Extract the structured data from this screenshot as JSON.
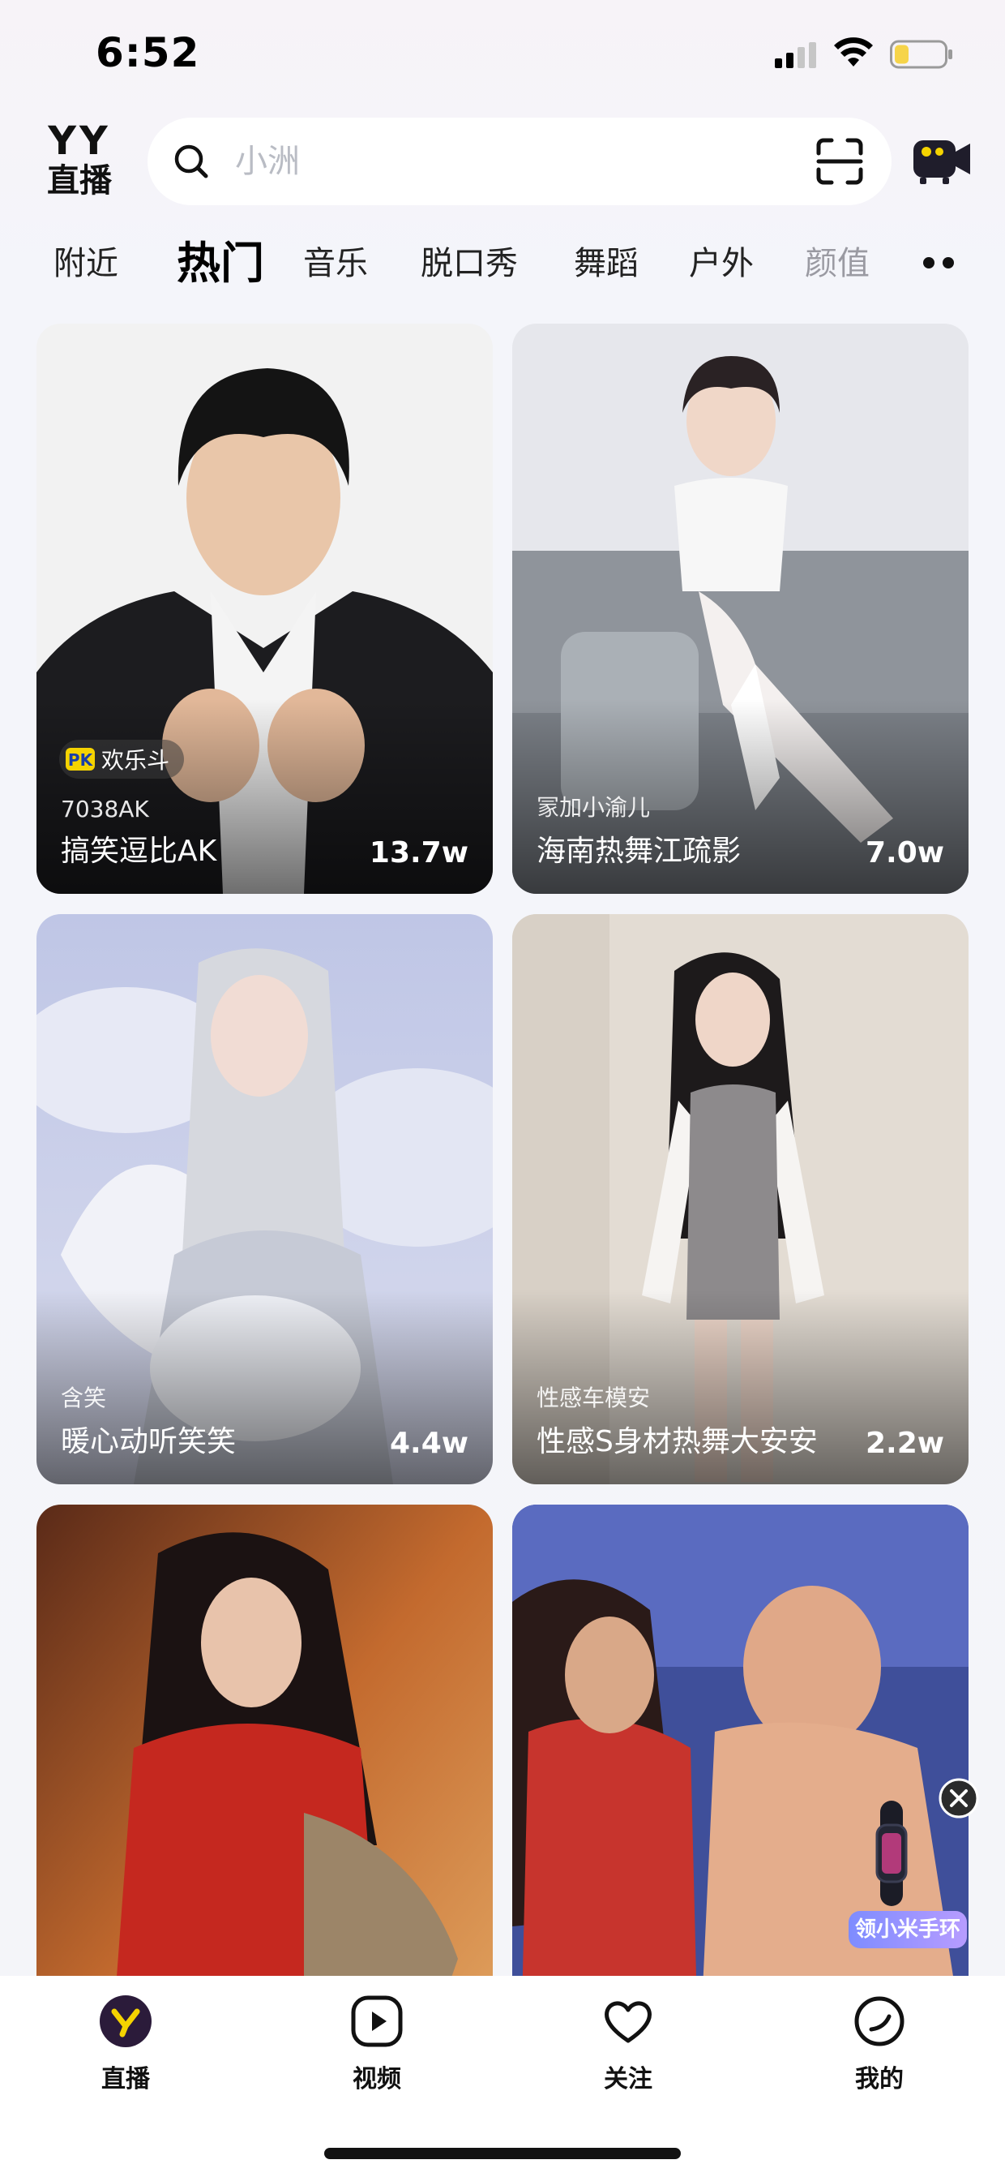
{
  "status_bar": {
    "time": "6:52"
  },
  "header": {
    "logo_top": "YY",
    "logo_bottom": "直播",
    "search_placeholder": "小洲"
  },
  "tabs": [
    {
      "label": "附近"
    },
    {
      "label": "热门",
      "active": true
    },
    {
      "label": "音乐"
    },
    {
      "label": "脱口秀"
    },
    {
      "label": "舞蹈"
    },
    {
      "label": "户外"
    },
    {
      "label": "颜值"
    }
  ],
  "cards": [
    {
      "badge": "欢乐斗",
      "subtitle": "7038AK",
      "title": "搞笑逗比AK",
      "views": "13.7w"
    },
    {
      "subtitle": "冡加小渝儿",
      "title": "海南热舞江疏影",
      "views": "7.0w"
    },
    {
      "subtitle": "含笑",
      "title": "暖心动听笑笑",
      "views": "4.4w"
    },
    {
      "subtitle": "性感车模安",
      "title": "性感S身材热舞大安安",
      "views": "2.2w"
    },
    {
      "subtitle": "",
      "title": "",
      "views": ""
    },
    {
      "subtitle": "",
      "title": "",
      "views": ""
    }
  ],
  "ad": {
    "tag": "领小米手环"
  },
  "bottom_nav": [
    {
      "label": "直播",
      "icon": "live-logo-icon",
      "active": true
    },
    {
      "label": "视频",
      "icon": "play-icon"
    },
    {
      "label": "关注",
      "icon": "heart-icon"
    },
    {
      "label": "我的",
      "icon": "profile-icon"
    }
  ],
  "colors": {
    "accent": "#2b1b3a",
    "logo_yellow": "#f5d300",
    "battery_fill": "#f6d44a"
  }
}
